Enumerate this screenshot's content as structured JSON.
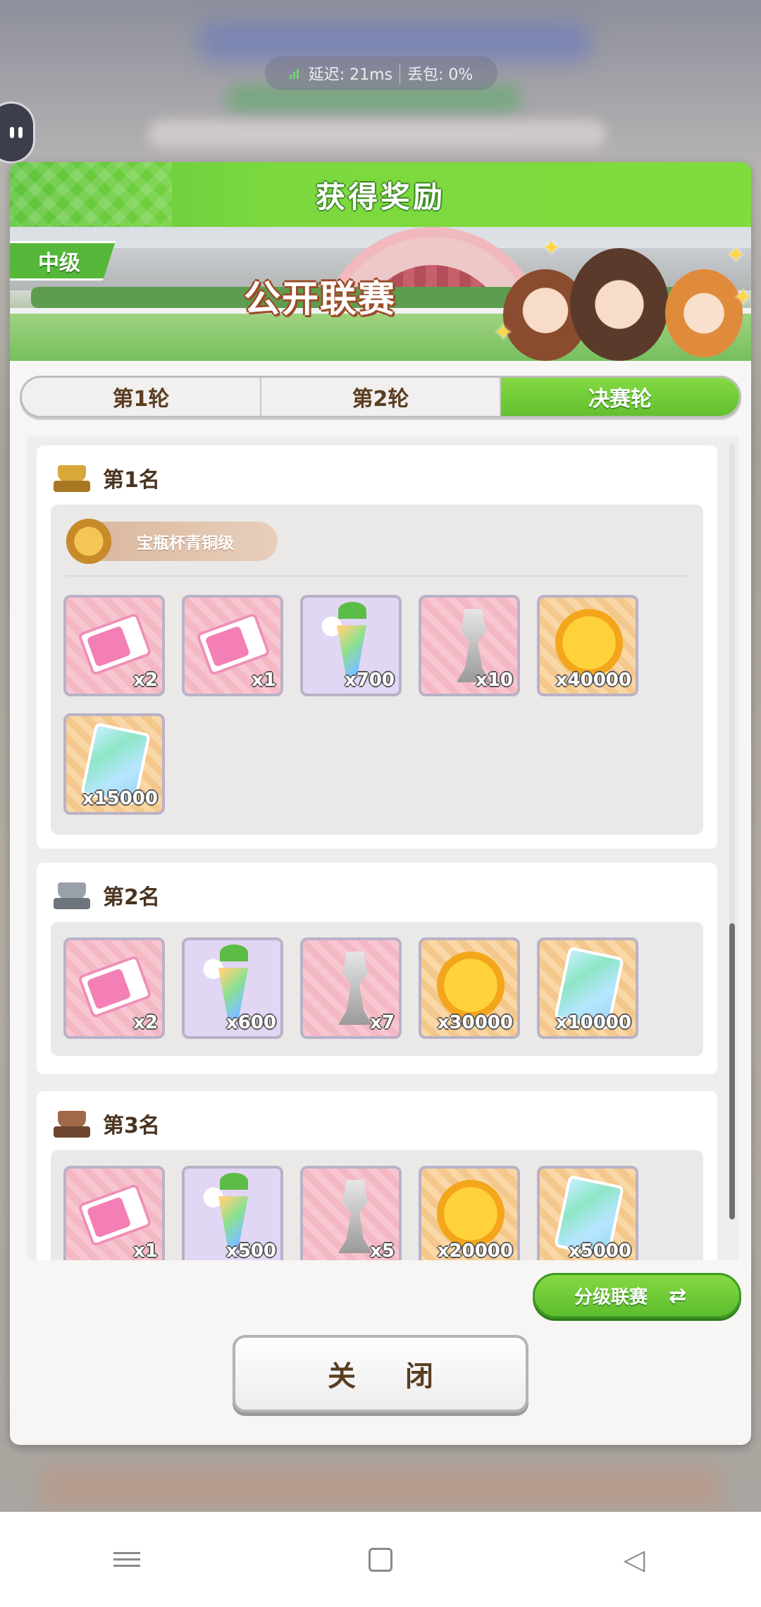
{
  "status": {
    "latency": "延迟: 21ms",
    "packet_loss": "丢包: 0%"
  },
  "dialog": {
    "title": "获得奖励",
    "level_tag": "中级",
    "event_name": "公开联赛",
    "tabs": [
      {
        "label": "第1轮",
        "active": false
      },
      {
        "label": "第2轮",
        "active": false
      },
      {
        "label": "决赛轮",
        "active": true
      }
    ],
    "ranks": [
      {
        "label": "第1名",
        "title_reward": "宝瓶杯青铜级",
        "items": [
          {
            "icon": "ticket-icon",
            "count": "x2"
          },
          {
            "icon": "ticket-icon",
            "count": "x1"
          },
          {
            "icon": "carrot-icon",
            "count": "x700"
          },
          {
            "icon": "horse-statue-icon",
            "count": "x10"
          },
          {
            "icon": "gold-coin-icon",
            "count": "x40000"
          },
          {
            "icon": "support-card-icon",
            "count": "x15000"
          }
        ]
      },
      {
        "label": "第2名",
        "items": [
          {
            "icon": "ticket-icon",
            "count": "x2"
          },
          {
            "icon": "carrot-icon",
            "count": "x600"
          },
          {
            "icon": "horse-statue-icon",
            "count": "x7"
          },
          {
            "icon": "gold-coin-icon",
            "count": "x30000"
          },
          {
            "icon": "support-card-icon",
            "count": "x10000"
          }
        ]
      },
      {
        "label": "第3名",
        "items": [
          {
            "icon": "ticket-icon",
            "count": "x1"
          },
          {
            "icon": "carrot-icon",
            "count": "x500"
          },
          {
            "icon": "horse-statue-icon",
            "count": "x5"
          },
          {
            "icon": "gold-coin-icon",
            "count": "x20000"
          },
          {
            "icon": "support-card-icon",
            "count": "x5000"
          }
        ]
      }
    ],
    "switch_button": "分级联赛",
    "close_button": "关 闭"
  },
  "colors": {
    "accent_green": "#6ccb3a",
    "text_brown": "#5a3d22"
  }
}
